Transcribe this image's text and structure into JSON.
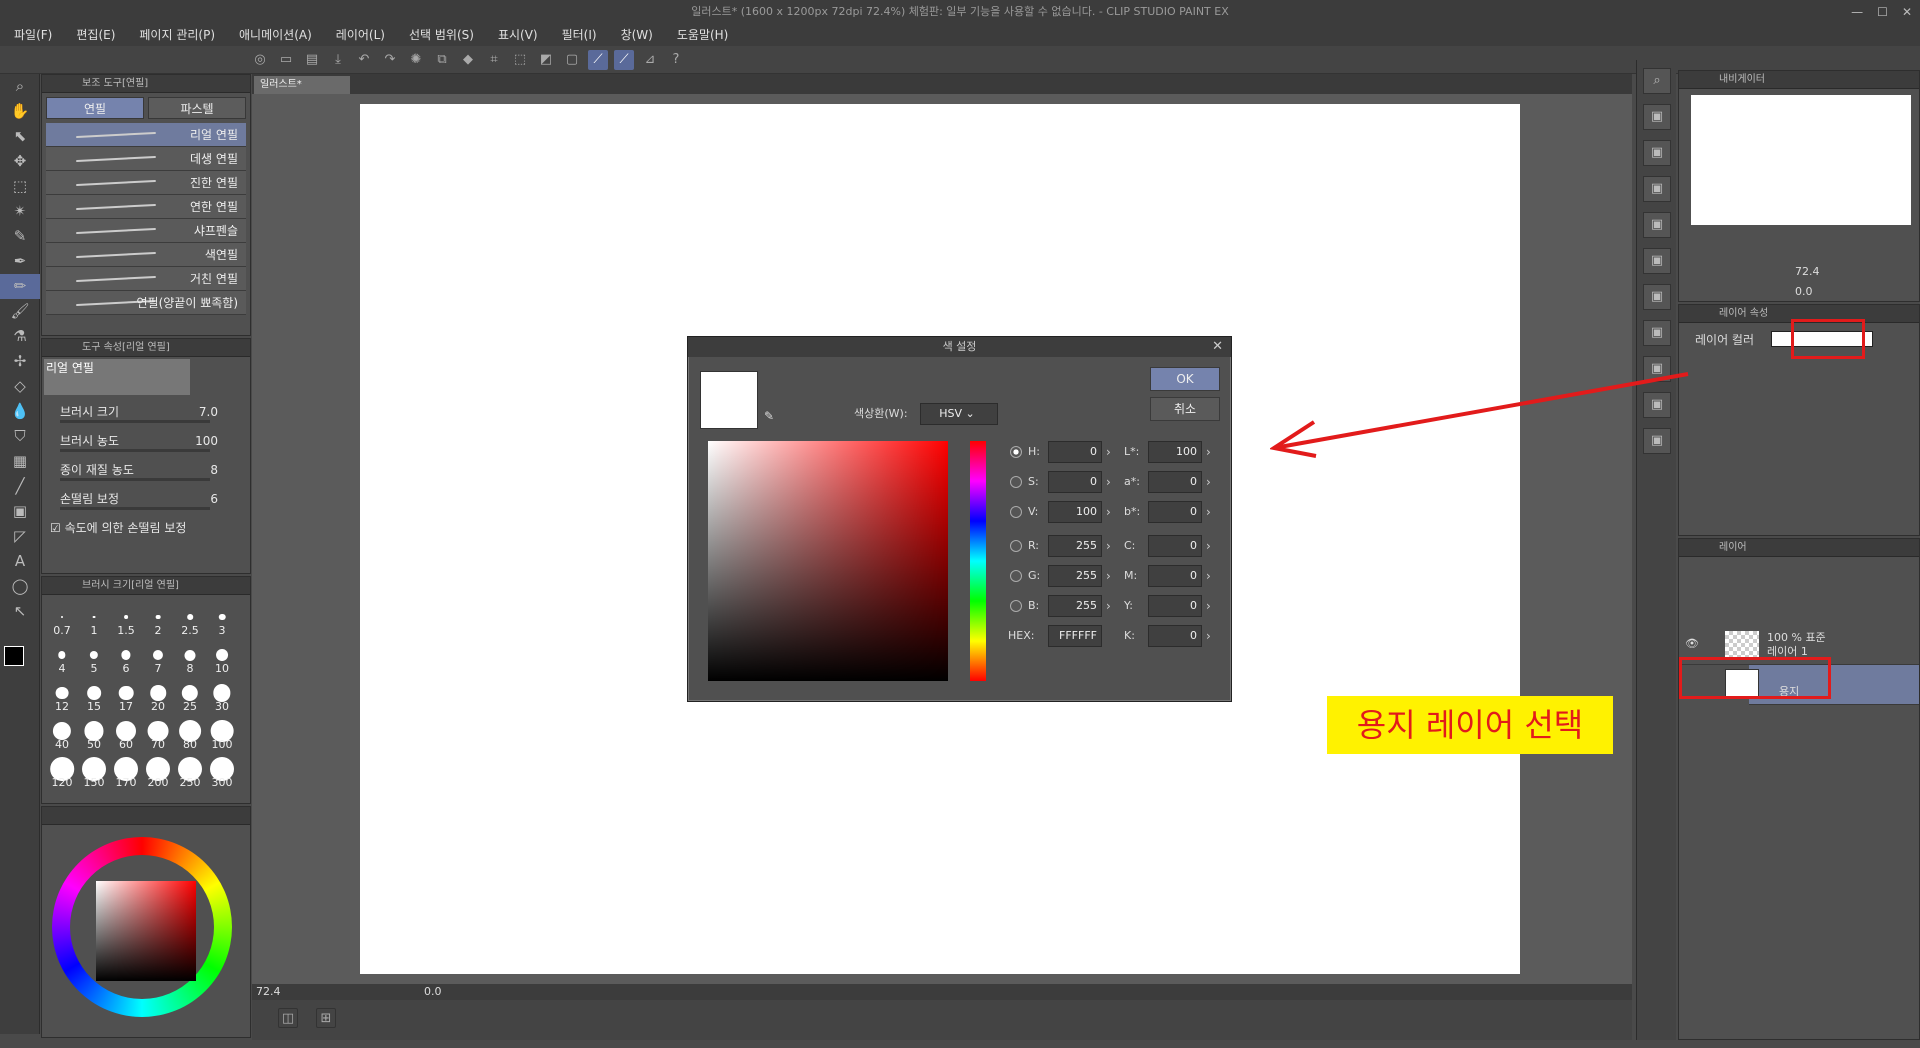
{
  "window": {
    "title": "일러스트* (1600 x 1200px 72dpi 72.4%)  체험판: 일부 기능을 사용할 수 없습니다. - CLIP STUDIO PAINT EX"
  },
  "menu": [
    "파일(F)",
    "편집(E)",
    "페이지 관리(P)",
    "애니메이션(A)",
    "레이어(L)",
    "선택 범위(S)",
    "표시(V)",
    "필터(I)",
    "창(W)",
    "도움말(H)"
  ],
  "subtool": {
    "title": "보조 도구[연필]",
    "tabs": [
      "연필",
      "파스텔"
    ],
    "items": [
      "리얼 연필",
      "데생 연필",
      "진한 연필",
      "연한 연필",
      "샤프펜슬",
      "색연필",
      "거친 연필",
      "연필(양끝이 뾰족함)"
    ]
  },
  "toolprop": {
    "title": "도구 속성[리얼 연필]",
    "preset": "리얼 연필",
    "props": [
      {
        "label": "브러시 크기",
        "value": "7.0"
      },
      {
        "label": "브러시 농도",
        "value": "100"
      },
      {
        "label": "종이 재질 농도",
        "value": "8"
      },
      {
        "label": "손떨림 보정",
        "value": "6"
      }
    ],
    "check_label": "속도에 의한 손떨림 보정"
  },
  "brushsize": {
    "title": "브러시 크기[리얼 연필]",
    "sizes": [
      "0.7",
      "1",
      "1.5",
      "2",
      "2.5",
      "3",
      "4",
      "5",
      "6",
      "7",
      "8",
      "10",
      "12",
      "15",
      "17",
      "20",
      "25",
      "30",
      "40",
      "50",
      "60",
      "70",
      "80",
      "100",
      "120",
      "150",
      "170",
      "200",
      "250",
      "300"
    ]
  },
  "canvas": {
    "tab": "일러스트*",
    "zoom": "72.4",
    "angle": "0.0"
  },
  "dialog": {
    "title": "색 설정",
    "ok": "OK",
    "cancel": "취소",
    "colorspace_label": "색상환(W):",
    "colorspace_value": "HSV",
    "fields": {
      "H": "0",
      "S": "0",
      "V": "100",
      "R": "255",
      "G": "255",
      "B": "255",
      "HEX": "FFFFFF",
      "L": "100",
      "a": "0",
      "b": "0",
      "C": "0",
      "M": "0",
      "Y": "0",
      "K": "0"
    },
    "labels": {
      "H": "H:",
      "S": "S:",
      "V": "V:",
      "R": "R:",
      "G": "G:",
      "B": "B:",
      "HEX": "HEX:",
      "L": "L*:",
      "a": "a*:",
      "b": "b*:",
      "C": "C:",
      "M": "M:",
      "Y": "Y:",
      "K": "K:"
    }
  },
  "navigator": {
    "title": "내비게이터",
    "zoom": "72.4",
    "angle": "0.0"
  },
  "layerprop": {
    "title": "레이어 속성",
    "color_label": "레이어 컬러"
  },
  "layers": {
    "title": "레이어",
    "items": [
      {
        "info": "100 % 표준",
        "name": "레이어 1"
      },
      {
        "info": "",
        "name": "용지"
      }
    ]
  },
  "annotation": {
    "callout": "용지 레이어 선택",
    "color": "#e21b1b",
    "bg": "#fff200"
  }
}
